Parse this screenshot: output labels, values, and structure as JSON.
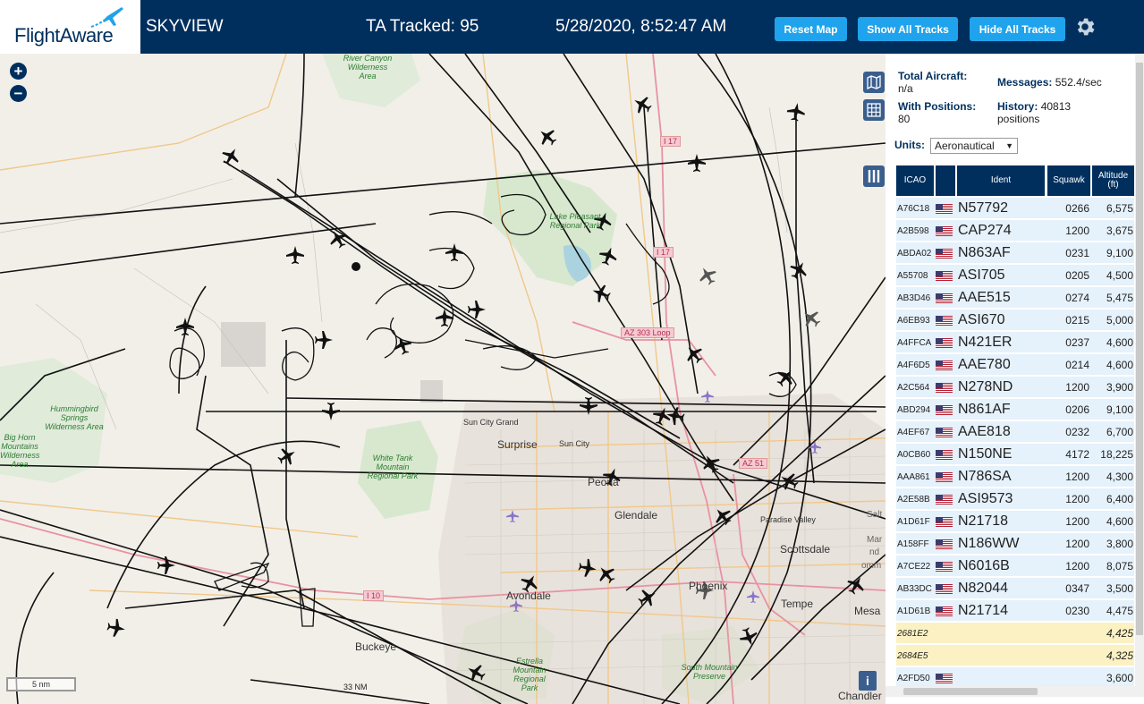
{
  "header": {
    "logo": "FlightAware",
    "app_title": "SKYVIEW",
    "tracked": "TA Tracked: 95",
    "clock": "5/28/2020, 8:52:47 AM",
    "reset_map": "Reset Map",
    "show_all_tracks": "Show All Tracks",
    "hide_all_tracks": "Hide All Tracks",
    "accent_color": "#1fa3ec",
    "bar_color": "#002f5d"
  },
  "map": {
    "zoom_in": "+",
    "zoom_out": "−",
    "scale_label": "5 nm",
    "range_label": "33 NM",
    "info": "i",
    "parks": [
      "River Canyon Wilderness Area",
      "Lake Pleasant Regional Park",
      "Hummingbird Springs Wilderness Area",
      "Big Horn Mountains Wilderness Area",
      "White Tank Mountain Regional Park",
      "Estrella Mountain Regional Park",
      "South Mountain Preserve"
    ],
    "cities": [
      "Sun City Grand",
      "Surprise",
      "Sun City",
      "Peoria",
      "Glendale",
      "Paradise Valley",
      "Scottsdale",
      "Avondale",
      "Phoenix",
      "Tempe",
      "Buckeye",
      "Mesa",
      "Chandler",
      "Salt",
      "Mar",
      "nd",
      "omm"
    ],
    "shields": [
      "I 17",
      "I 17",
      "AZ 303 Loop",
      "AZ 51",
      "I 10"
    ]
  },
  "stats": {
    "total_aircraft_label": "Total Aircraft:",
    "total_aircraft_value": "n/a",
    "with_positions_label": "With Positions:",
    "with_positions_value": "80",
    "messages_label": "Messages:",
    "messages_value": "552.4/sec",
    "history_label": "History:",
    "history_value": "40813 positions"
  },
  "units": {
    "label": "Units:",
    "selected": "Aeronautical"
  },
  "table": {
    "headers": {
      "icao": "ICAO",
      "ident": "Ident",
      "squawk": "Squawk",
      "altitude": "Altitude (ft)"
    },
    "rows": [
      {
        "icao": "A76C18",
        "ident": "N57792",
        "squawk": "0266",
        "alt": "6,575",
        "flag": true,
        "yellow": false
      },
      {
        "icao": "A2B598",
        "ident": "CAP274",
        "squawk": "1200",
        "alt": "3,675",
        "flag": true,
        "yellow": false
      },
      {
        "icao": "ABDA02",
        "ident": "N863AF",
        "squawk": "0231",
        "alt": "9,100",
        "flag": true,
        "yellow": false
      },
      {
        "icao": "A55708",
        "ident": "ASI705",
        "squawk": "0205",
        "alt": "4,500",
        "flag": true,
        "yellow": false
      },
      {
        "icao": "AB3D46",
        "ident": "AAE515",
        "squawk": "0274",
        "alt": "5,475",
        "flag": true,
        "yellow": false
      },
      {
        "icao": "A6EB93",
        "ident": "ASI670",
        "squawk": "0215",
        "alt": "5,000",
        "flag": true,
        "yellow": false
      },
      {
        "icao": "A4FFCA",
        "ident": "N421ER",
        "squawk": "0237",
        "alt": "4,600",
        "flag": true,
        "yellow": false
      },
      {
        "icao": "A4F6D5",
        "ident": "AAE780",
        "squawk": "0214",
        "alt": "4,600",
        "flag": true,
        "yellow": false
      },
      {
        "icao": "A2C564",
        "ident": "N278ND",
        "squawk": "1200",
        "alt": "3,900",
        "flag": true,
        "yellow": false
      },
      {
        "icao": "ABD294",
        "ident": "N861AF",
        "squawk": "0206",
        "alt": "9,100",
        "flag": true,
        "yellow": false
      },
      {
        "icao": "A4EF67",
        "ident": "AAE818",
        "squawk": "0232",
        "alt": "6,700",
        "flag": true,
        "yellow": false
      },
      {
        "icao": "A0CB60",
        "ident": "N150NE",
        "squawk": "4172",
        "alt": "18,225",
        "flag": true,
        "yellow": false
      },
      {
        "icao": "AAA861",
        "ident": "N786SA",
        "squawk": "1200",
        "alt": "4,300",
        "flag": true,
        "yellow": false
      },
      {
        "icao": "A2E58B",
        "ident": "ASI9573",
        "squawk": "1200",
        "alt": "6,400",
        "flag": true,
        "yellow": false
      },
      {
        "icao": "A1D61F",
        "ident": "N21718",
        "squawk": "1200",
        "alt": "4,600",
        "flag": true,
        "yellow": false
      },
      {
        "icao": "A158FF",
        "ident": "N186WW",
        "squawk": "1200",
        "alt": "3,800",
        "flag": true,
        "yellow": false
      },
      {
        "icao": "A7CE22",
        "ident": "N6016B",
        "squawk": "1200",
        "alt": "8,075",
        "flag": true,
        "yellow": false
      },
      {
        "icao": "AB33DC",
        "ident": "N82044",
        "squawk": "0347",
        "alt": "3,500",
        "flag": true,
        "yellow": false
      },
      {
        "icao": "A1D61B",
        "ident": "N21714",
        "squawk": "0230",
        "alt": "4,475",
        "flag": true,
        "yellow": false
      },
      {
        "icao": "2681E2",
        "ident": "",
        "squawk": "",
        "alt": "4,425",
        "flag": false,
        "yellow": true
      },
      {
        "icao": "2684E5",
        "ident": "",
        "squawk": "",
        "alt": "4,325",
        "flag": false,
        "yellow": true
      },
      {
        "icao": "A2FD50",
        "ident": "",
        "squawk": "",
        "alt": "3,600",
        "flag": true,
        "yellow": false
      }
    ]
  }
}
